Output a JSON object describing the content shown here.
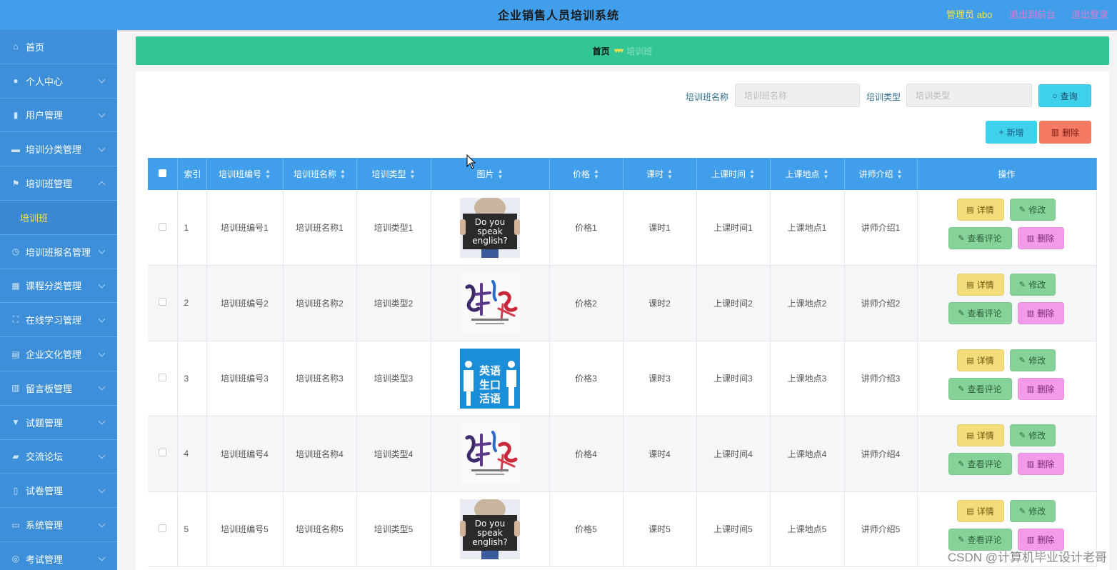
{
  "header": {
    "title": "企业销售人员培训系统",
    "admin": "管理员 abo",
    "back_to_front": "退出到前台",
    "logout": "退出登录"
  },
  "sidebar": {
    "items": [
      {
        "label": "首页",
        "icon": "home-icon"
      },
      {
        "label": "个人中心",
        "icon": "user-icon"
      },
      {
        "label": "用户管理",
        "icon": "mic-icon"
      },
      {
        "label": "培训分类管理",
        "icon": "briefcase-icon"
      },
      {
        "label": "培训班管理",
        "icon": "flag-icon",
        "expanded": true,
        "sub": "培训班"
      },
      {
        "label": "培训班报名管理",
        "icon": "clock-icon"
      },
      {
        "label": "课程分类管理",
        "icon": "grid-icon"
      },
      {
        "label": "在线学习管理",
        "icon": "frame-icon"
      },
      {
        "label": "企业文化管理",
        "icon": "doc-icon"
      },
      {
        "label": "留言板管理",
        "icon": "bar-chart-icon"
      },
      {
        "label": "试题管理",
        "icon": "flag-icon"
      },
      {
        "label": "交流论坛",
        "icon": "ticket-icon"
      },
      {
        "label": "试卷管理",
        "icon": "phone-icon"
      },
      {
        "label": "系统管理",
        "icon": "monitor-icon"
      },
      {
        "label": "考试管理",
        "icon": "target-icon"
      }
    ]
  },
  "breadcrumb": {
    "home": "首页",
    "current": "培训班"
  },
  "search": {
    "name_label": "培训班名称",
    "name_placeholder": "培训班名称",
    "type_label": "培训类型",
    "type_placeholder": "培训类型",
    "query_label": "查询"
  },
  "toolbar": {
    "add_label": "新增",
    "delete_label": "删除"
  },
  "table": {
    "columns": [
      "索引",
      "培训班编号",
      "培训班名称",
      "培训类型",
      "图片",
      "价格",
      "课时",
      "上课时间",
      "上课地点",
      "讲师介绍",
      "操作"
    ],
    "rows": [
      {
        "index": "1",
        "code": "培训班编号1",
        "name": "培训班名称1",
        "type": "培训类型1",
        "image": "do-you-speak-english",
        "price": "价格1",
        "hours": "课时1",
        "time": "上课时间1",
        "place": "上课地点1",
        "intro": "讲师介绍1"
      },
      {
        "index": "2",
        "code": "培训班编号2",
        "name": "培训班名称2",
        "type": "培训类型2",
        "image": "calligraphy-logo",
        "price": "价格2",
        "hours": "课时2",
        "time": "上课时间2",
        "place": "上课地点2",
        "intro": "讲师介绍2"
      },
      {
        "index": "3",
        "code": "培训班编号3",
        "name": "培训班名称3",
        "type": "培训类型3",
        "image": "english-sign",
        "price": "价格3",
        "hours": "课时3",
        "time": "上课时间3",
        "place": "上课地点3",
        "intro": "讲师介绍3"
      },
      {
        "index": "4",
        "code": "培训班编号4",
        "name": "培训班名称4",
        "type": "培训类型4",
        "image": "calligraphy-logo",
        "price": "价格4",
        "hours": "课时4",
        "time": "上课时间4",
        "place": "上课地点4",
        "intro": "讲师介绍4"
      },
      {
        "index": "5",
        "code": "培训班编号5",
        "name": "培训班名称5",
        "type": "培训类型5",
        "image": "do-you-speak-english",
        "price": "价格5",
        "hours": "课时5",
        "time": "上课时间5",
        "place": "上课地点5",
        "intro": "讲师介绍5"
      }
    ],
    "actions": {
      "detail": "详情",
      "edit": "修改",
      "review": "查看评论",
      "remove": "删除"
    }
  },
  "images": {
    "speak_text": [
      "Do you",
      "speak",
      "english?"
    ],
    "sign_text": [
      "英语",
      "生口",
      "活语"
    ]
  },
  "watermark": "CSDN @计算机毕业设计老哥",
  "colors": {
    "header": "#409eea",
    "sidebar": "#3c8fd8",
    "breadcrumb": "#33c692",
    "accent_yellow": "#f5e04a"
  }
}
